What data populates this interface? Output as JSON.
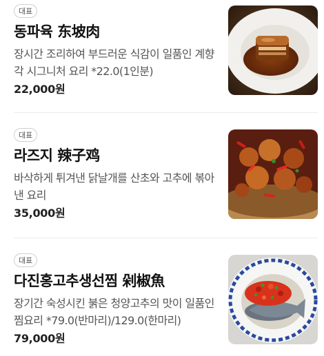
{
  "menu": {
    "items": [
      {
        "badge": "대표",
        "name": "동파육 东坡肉",
        "description": "장시간 조리하여 부드러운 식감이 일품인 계향각 시그니처 요리 *22.0(1인분)",
        "price": "22,000원",
        "image_icon": "braised-pork-photo-icon"
      },
      {
        "badge": "대표",
        "name": "라즈지 辣子鸡",
        "description": "바삭하게 튀겨낸 닭날개를 산초와 고추에 볶아낸 요리",
        "price": "35,000원",
        "image_icon": "spicy-chicken-photo-icon"
      },
      {
        "badge": "대표",
        "name": "다진홍고추생선찜 剁椒魚",
        "description": "장기간 숙성시킨 붉은 청양고추의 맛이 일품인 찜요리 *79.0(반마리)/129.0(한마리)",
        "price": "79,000원",
        "image_icon": "steamed-fish-chili-photo-icon"
      }
    ]
  },
  "colors": {
    "text_primary": "#111111",
    "text_secondary": "#555555",
    "badge_border": "#cfcfcf",
    "divider": "#ececec"
  }
}
